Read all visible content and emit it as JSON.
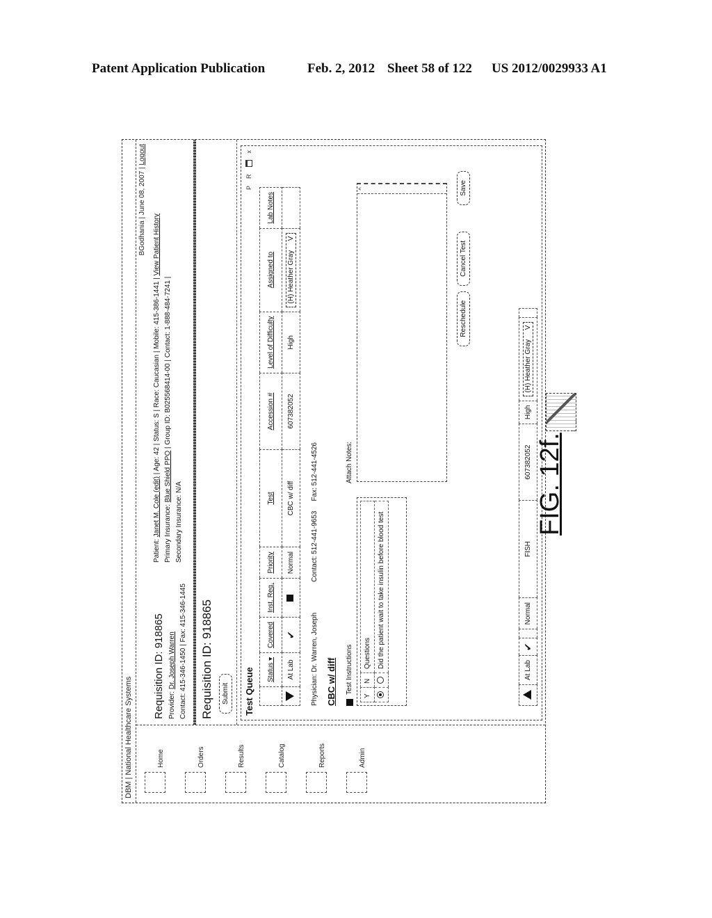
{
  "publication": {
    "title": "Patent Application Publication",
    "date": "Feb. 2, 2012",
    "sheet": "Sheet 58 of 122",
    "number": "US 2012/0029933 A1"
  },
  "window": {
    "title": "DBM | National Healthcare Systems"
  },
  "sidebar": {
    "items": [
      {
        "label": "Home",
        "icon": "home-icon"
      },
      {
        "label": "Orders",
        "icon": "orders-icon"
      },
      {
        "label": "Results",
        "icon": "results-icon"
      },
      {
        "label": "Catalog",
        "icon": "catalog-icon"
      },
      {
        "label": "Reports",
        "icon": "reports-icon"
      },
      {
        "label": "Admin",
        "icon": "admin-icon"
      }
    ]
  },
  "topbar": {
    "user": "BGodhania",
    "date": "June 08, 2007",
    "logout": "Logout"
  },
  "requisition": {
    "id_line": "Requisition ID: 918865",
    "provider_label": "Provider:",
    "provider": "Dr. Joseph Warren",
    "contact_line": "Contact: 415-346-1450  |  Fax: 415-346-1445",
    "patient_label": "Patient:",
    "patient": "Janet M. Cole (edit)",
    "patient_details": "| Age: 42 | Status: S | Race: Caucasian | Mobile: 415-386-1441 |",
    "view_history": "View Patient History",
    "primary_label": "Primary Insurance:",
    "primary": "Blue Shield PPO",
    "group_line": "| Group ID: B025568414-00 | Contact: 1-888-484-7241 |",
    "secondary_line": "Secondary Insurance: N/A"
  },
  "page_title": "Requisition ID: 918865",
  "submit_label": "Submit",
  "test_queue": {
    "title": "Test Queue",
    "window_controls": [
      "P",
      "R",
      "□",
      "x"
    ],
    "columns": [
      "",
      "Status ▾",
      "Covered",
      "Inst. Req.",
      "Priority",
      "Test",
      "Accession #",
      "Level of Difficulty",
      "Assigned to",
      "Lab Notes"
    ],
    "rows": [
      {
        "expander": "collapse",
        "status": "At Lab",
        "covered": "✔",
        "inst_req": "■",
        "priority": "Normal",
        "test": "CBC w/ diff",
        "accession": "607382052",
        "difficulty": "High",
        "assigned": "(H) Heather Gray",
        "lab_notes": ""
      },
      {
        "expander": "expand",
        "status": "At Lab",
        "covered": "✔",
        "inst_req": "",
        "priority": "Normal",
        "test": "FISH",
        "accession": "607382052",
        "difficulty": "High",
        "assigned": "(H) Heather Gray",
        "lab_notes": ""
      }
    ],
    "dropdown_arrow": "V"
  },
  "detail": {
    "physician": "Physician: Dr. Warren, Joseph",
    "contact": "Contact: 512-441-9653",
    "fax": "Fax: 512-441-4526",
    "test_name": "CBC w/ diff",
    "instructions_label": "Test Instructions",
    "questions_header": {
      "y": "Y",
      "n": "N",
      "q": "Questions"
    },
    "questions": [
      {
        "text": "Did the patient wait to take insulin before blood test",
        "answer": "Y"
      }
    ],
    "attach_notes_label": "Attach Notes:",
    "notes_value": ""
  },
  "actions": {
    "reschedule": "Reschedule",
    "cancel": "Cancel Test",
    "save": "Save"
  },
  "figure_label": "FIG. 12f."
}
